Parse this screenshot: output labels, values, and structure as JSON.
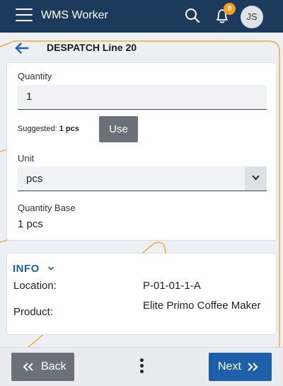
{
  "app": {
    "title": "WMS Worker",
    "notification_count": "0",
    "user_initials": "JS"
  },
  "header": {
    "title": "DESPATCH Line 20"
  },
  "form": {
    "quantity_label": "Quantity",
    "quantity_value": "1",
    "suggested_prefix": "Suggested:",
    "suggested_value": "1 pcs",
    "use_label": "Use",
    "unit_label": "Unit",
    "unit_value": "pcs",
    "quantity_base_label": "Quantity Base",
    "quantity_base_value": "1 pcs"
  },
  "info": {
    "heading": "INFO",
    "location_label": "Location:",
    "location_value": "P-01-01-1-A",
    "product_label": "Product:",
    "product_value": "Elite Primo Coffee Maker"
  },
  "footer": {
    "back_label": "Back",
    "next_label": "Next"
  },
  "colors": {
    "topbar": "#1c3a5c",
    "accent": "#1d5fa8",
    "badge": "#f0a01c",
    "decor_line": "#f0a01c",
    "button_grey": "#6b7178"
  },
  "icons": [
    "hamburger-icon",
    "search-icon",
    "bell-icon",
    "back-arrow-icon",
    "chevron-down-icon",
    "double-chevron-left-icon",
    "more-vertical-icon",
    "double-chevron-right-icon"
  ]
}
